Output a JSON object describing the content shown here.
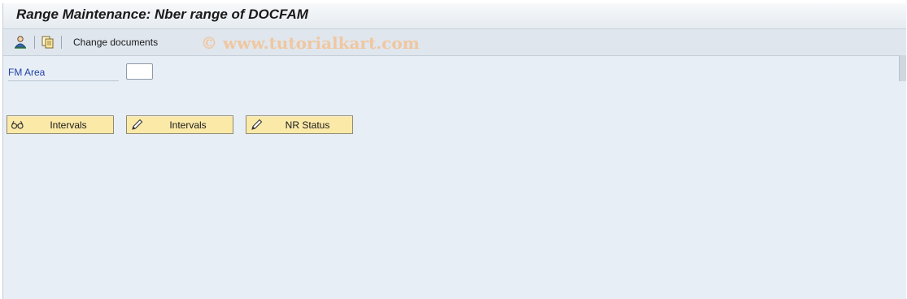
{
  "window": {
    "title": "Range Maintenance: Nber range of DOCFAM"
  },
  "toolbar": {
    "icons": [
      "person-icon",
      "copy-documents-icon"
    ],
    "change_documents_label": "Change documents"
  },
  "watermark": {
    "text": "© www.tutorialkart.com"
  },
  "form": {
    "fm_area_label": "FM Area",
    "fm_area_value": ""
  },
  "buttons": {
    "display_intervals": {
      "label": "Intervals",
      "icon": "glasses-icon"
    },
    "change_intervals": {
      "label": "Intervals",
      "icon": "pencil-icon"
    },
    "nr_status": {
      "label": "NR Status",
      "icon": "pencil-icon"
    }
  },
  "colors": {
    "background": "#e8eef5",
    "button": "#fbe9a8",
    "label_blue": "#1f3fa8"
  }
}
